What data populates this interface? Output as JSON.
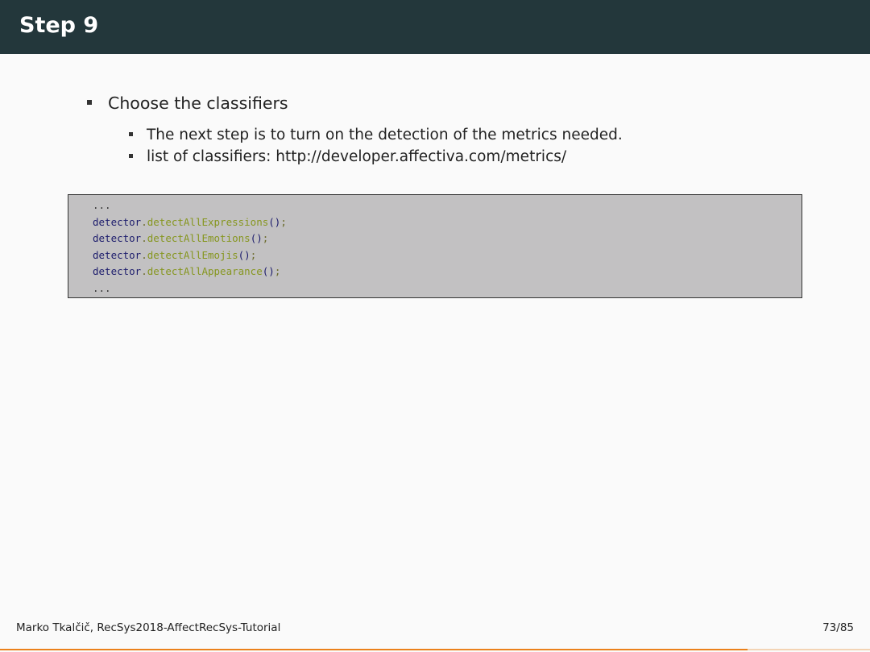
{
  "slide": {
    "title": "Step 9",
    "bullets": [
      {
        "text": "Choose the classifiers",
        "subitems": [
          "The next step is to turn on the detection of the metrics needed.",
          "list of classifiers: http://developer.affectiva.com/metrics/"
        ]
      }
    ],
    "code": {
      "ellipsis": "...",
      "lines": [
        {
          "object": "detector",
          "method": "detectAllExpressions",
          "suffix_paren": "()",
          "suffix_semi": ";"
        },
        {
          "object": "detector",
          "method": "detectAllEmotions",
          "suffix_paren": "()",
          "suffix_semi": ";"
        },
        {
          "object": "detector",
          "method": "detectAllEmojis",
          "suffix_paren": "()",
          "suffix_semi": ";"
        },
        {
          "object": "detector",
          "method": "detectAllAppearance",
          "suffix_paren": "()",
          "suffix_semi": ";"
        }
      ]
    }
  },
  "footer": {
    "author_event": "Marko Tkalčič, RecSys2018-AffectRecSys-Tutorial",
    "page": "73/85"
  },
  "progress": {
    "fraction": 0.8588
  },
  "colors": {
    "header_bg": "#23373b",
    "accent": "#eb811b",
    "code_bg": "#c2c1c2",
    "code_object": "#1c1c6c",
    "code_method": "#86961f"
  }
}
